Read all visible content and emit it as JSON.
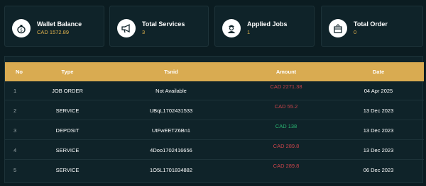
{
  "summary_cards": [
    {
      "icon": "money-bag-icon",
      "title": "Wallet Balance",
      "value": "CAD 1572.89"
    },
    {
      "icon": "megaphone-icon",
      "title": "Total Services",
      "value": "3"
    },
    {
      "icon": "worker-icon",
      "title": "Applied Jobs",
      "value": "1"
    },
    {
      "icon": "order-box-icon",
      "title": "Total Order",
      "value": "0"
    }
  ],
  "table": {
    "headers": {
      "no": "No",
      "type": "Type",
      "tid": "Tsnid",
      "amount": "Amount",
      "date": "Date"
    },
    "rows": [
      {
        "no": "1",
        "type": "JOB ORDER",
        "tid": "Not Available",
        "amount": "CAD 2271.38",
        "amount_status": "debit",
        "date": "04 Apr 2025"
      },
      {
        "no": "2",
        "type": "SERVICE",
        "tid": "UBqL1702431533",
        "amount": "CAD 55.2",
        "amount_status": "debit",
        "date": "13 Dec 2023"
      },
      {
        "no": "3",
        "type": "DEPOSIT",
        "tid": "UtFwEETZ6Bn1",
        "amount": "CAD 138",
        "amount_status": "credit",
        "date": "13 Dec 2023"
      },
      {
        "no": "4",
        "type": "SERVICE",
        "tid": "4Doo1702416656",
        "amount": "CAD 289.8",
        "amount_status": "debit",
        "date": "13 Dec 2023"
      },
      {
        "no": "5",
        "type": "SERVICE",
        "tid": "1O5L1701834882",
        "amount": "CAD 289.8",
        "amount_status": "debit",
        "date": "06 Dec 2023"
      }
    ]
  },
  "colors": {
    "background": "#0b1c21",
    "panel": "#0f2329",
    "accent": "#d9ab51",
    "debit": "#c8434a",
    "credit": "#2bb673"
  }
}
